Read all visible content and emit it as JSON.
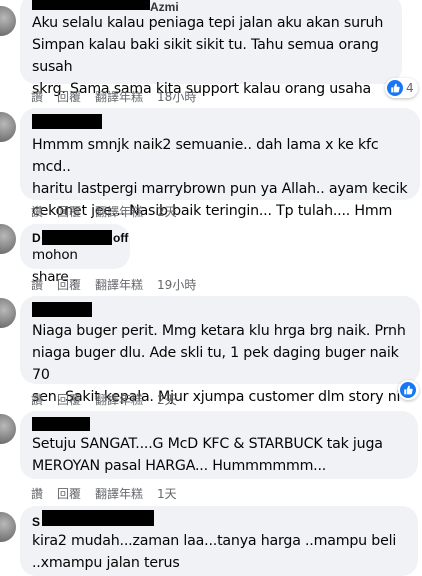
{
  "actions": {
    "like": "讚",
    "reply": "回覆",
    "translate": "翻譯年糕"
  },
  "comments": [
    {
      "name": "Azmi",
      "text": "Aku selalu kalau peniaga tepi jalan aku akan suruh\nSimpan kalau baki sikit sikit tu. Tahu semua orang susah\nskrg. Sama sama kita support kalau orang usaha",
      "time": "18小時",
      "reactions": "4"
    },
    {
      "name": "",
      "text": "Hmmm smnjk naik2 semuanie.. dah lama x ke kfc mcd..\nharitu lastpergi marrybrown pun ya Allah.. ayam kecik\ncekonet jee... Nasib baik teringin... Tp tulah.... Hmm",
      "time": "2天"
    },
    {
      "name_prefix": "D",
      "name_suffix": "off",
      "text": "mohon share .",
      "time": "19小時"
    },
    {
      "name": "",
      "text": "Niaga buger perit. Mmg ketara klu hrga brg naik. Prnh\nniaga buger dlu. Ade skli tu, 1 pek daging buger naik 70\nsen. Sakit kepala. Mjur xjumpa customer dlm story ni",
      "time": "2天"
    },
    {
      "name": "",
      "text": "Setuju SANGAT....G McD KFC & STARBUCK tak juga\nMEROYAN pasal HARGA... Hummmmmm...",
      "time": "1天"
    },
    {
      "name_prefix": "S",
      "text": "kira2 mudah...zaman laa...tanya harga ..mampu beli\n..xmampu jalan terus"
    }
  ],
  "colors": {
    "bubble": "#f0f2f5",
    "meta_text": "#65676b",
    "like_blue": "#1877f2"
  }
}
